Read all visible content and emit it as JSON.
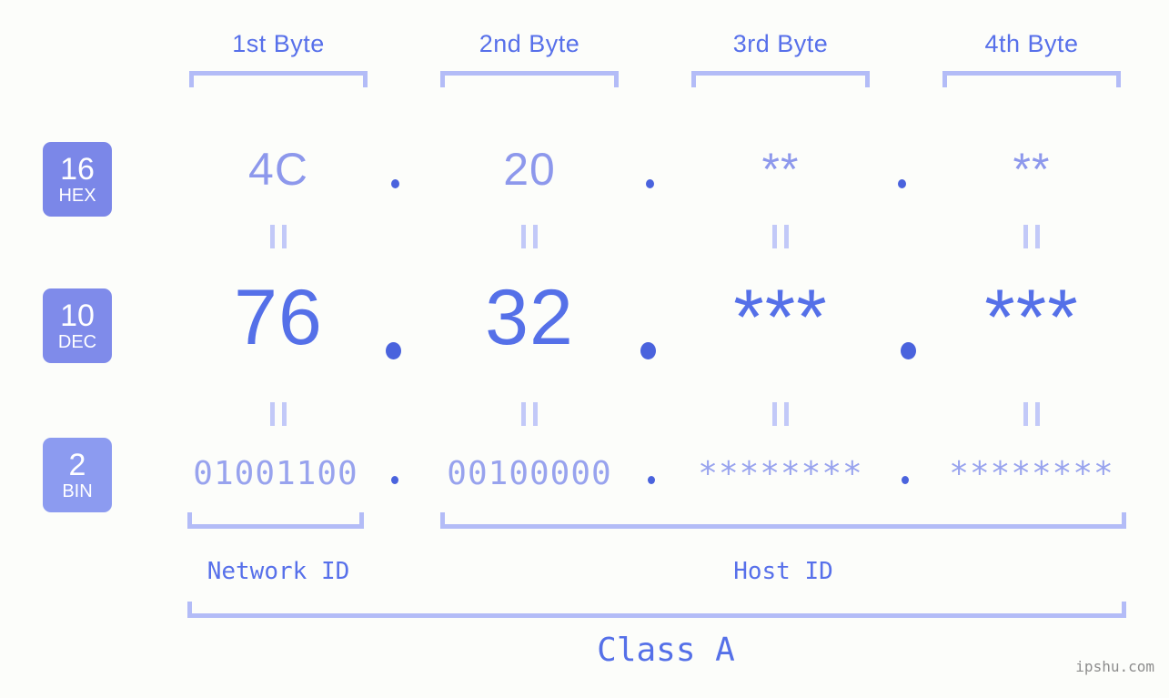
{
  "meta": {
    "watermark": "ipshu.com",
    "background_color": "#fcfdfa",
    "bracket_color": "#b3bcf7",
    "dot_color": "#4a63dd"
  },
  "byte_headers": [
    {
      "label": "1st Byte"
    },
    {
      "label": "2nd Byte"
    },
    {
      "label": "3rd Byte"
    },
    {
      "label": "4th Byte"
    }
  ],
  "rows": [
    {
      "badge": {
        "number": "16",
        "name": "HEX",
        "color": "#7b87e8"
      },
      "values": [
        "4C",
        "20",
        "**",
        "**"
      ],
      "separator": "."
    },
    {
      "badge": {
        "number": "10",
        "name": "DEC",
        "color": "#7f8bea"
      },
      "values": [
        "76",
        "32",
        "***",
        "***"
      ],
      "separator": "."
    },
    {
      "badge": {
        "number": "2",
        "name": "BIN",
        "color": "#8c9bf0"
      },
      "values": [
        "01001100",
        "00100000",
        "********",
        "********"
      ],
      "separator": "."
    }
  ],
  "segments": [
    {
      "label": "Network ID"
    },
    {
      "label": "Host ID"
    }
  ],
  "class": {
    "label": "Class A"
  }
}
